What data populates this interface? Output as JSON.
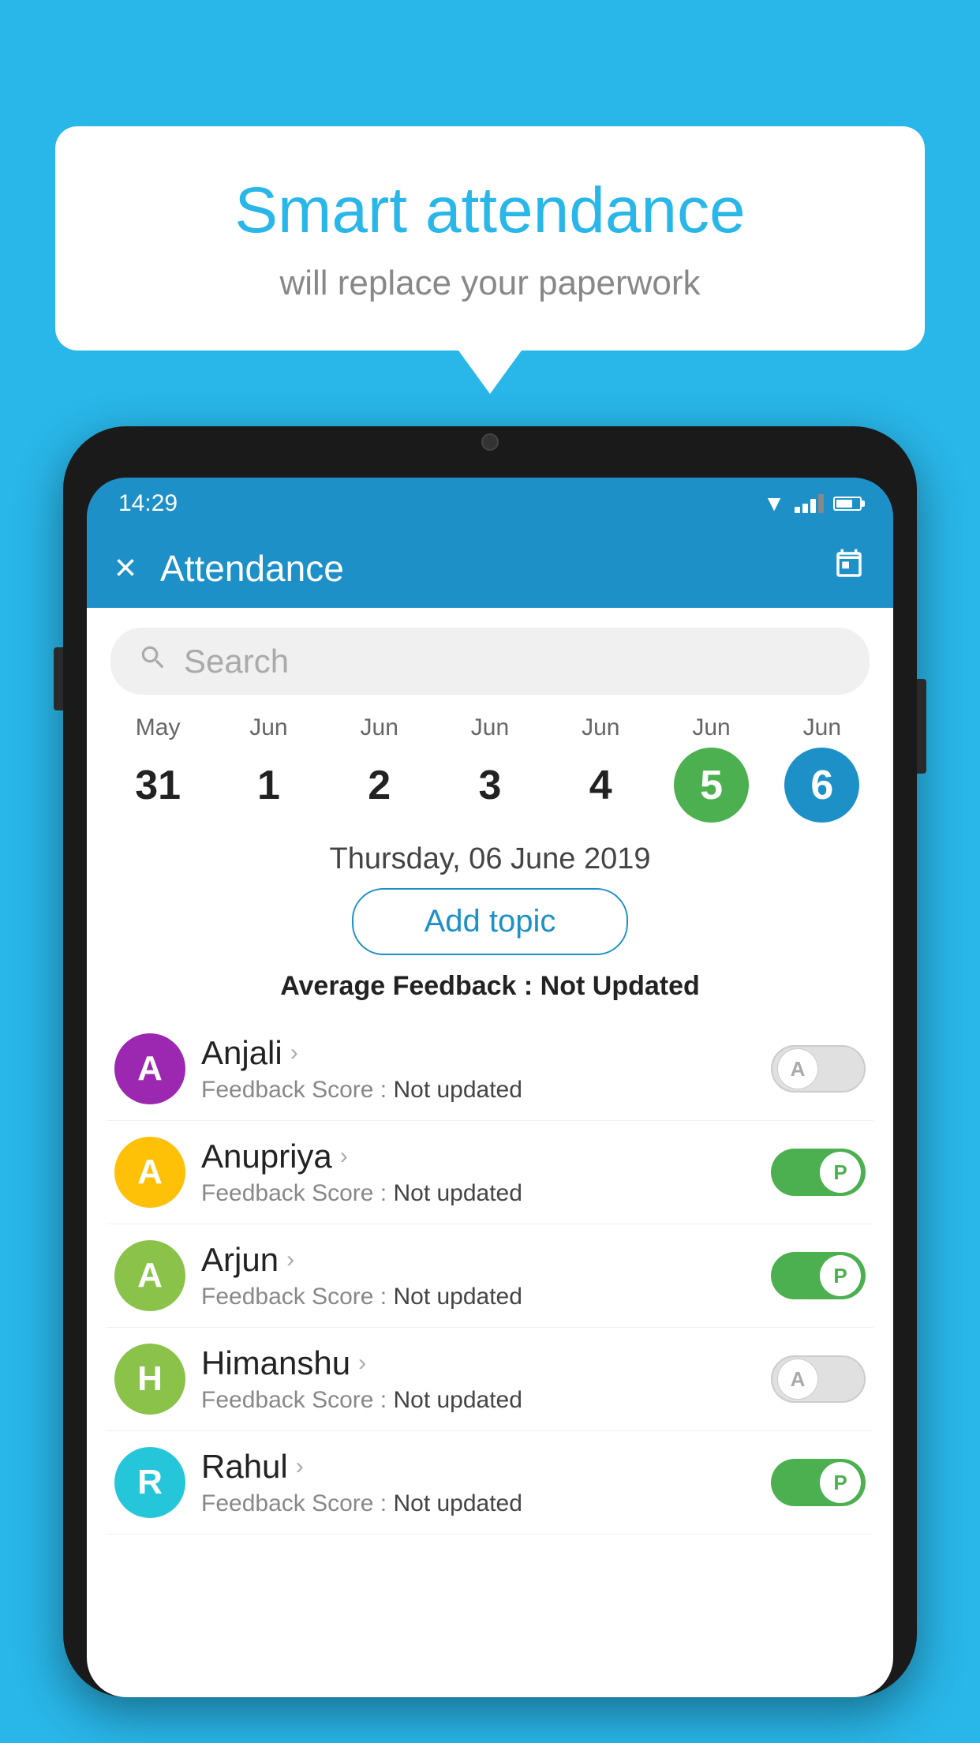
{
  "background_color": "#29b6e8",
  "speech_bubble": {
    "title": "Smart attendance",
    "subtitle": "will replace your paperwork"
  },
  "status_bar": {
    "time": "14:29",
    "wifi": "▼",
    "battery_label": "battery"
  },
  "app_header": {
    "close_label": "×",
    "title": "Attendance",
    "calendar_label": "📅"
  },
  "search": {
    "placeholder": "Search"
  },
  "calendar": {
    "days": [
      {
        "month": "May",
        "num": "31",
        "highlight": "none"
      },
      {
        "month": "Jun",
        "num": "1",
        "highlight": "none"
      },
      {
        "month": "Jun",
        "num": "2",
        "highlight": "none"
      },
      {
        "month": "Jun",
        "num": "3",
        "highlight": "none"
      },
      {
        "month": "Jun",
        "num": "4",
        "highlight": "none"
      },
      {
        "month": "Jun",
        "num": "5",
        "highlight": "green"
      },
      {
        "month": "Jun",
        "num": "6",
        "highlight": "blue"
      }
    ]
  },
  "selected_date": "Thursday, 06 June 2019",
  "add_topic_label": "Add topic",
  "avg_feedback_label": "Average Feedback : ",
  "avg_feedback_value": "Not Updated",
  "students": [
    {
      "name": "Anjali",
      "initial": "A",
      "color": "#9c27b0",
      "feedback_label": "Feedback Score : ",
      "feedback_value": "Not updated",
      "toggle": "off",
      "toggle_label": "A"
    },
    {
      "name": "Anupriya",
      "initial": "A",
      "color": "#ffc107",
      "feedback_label": "Feedback Score : ",
      "feedback_value": "Not updated",
      "toggle": "on",
      "toggle_label": "P"
    },
    {
      "name": "Arjun",
      "initial": "A",
      "color": "#8bc34a",
      "feedback_label": "Feedback Score : ",
      "feedback_value": "Not updated",
      "toggle": "on",
      "toggle_label": "P"
    },
    {
      "name": "Himanshu",
      "initial": "H",
      "color": "#8bc34a",
      "feedback_label": "Feedback Score : ",
      "feedback_value": "Not updated",
      "toggle": "off",
      "toggle_label": "A"
    },
    {
      "name": "Rahul",
      "initial": "R",
      "color": "#26c6da",
      "feedback_label": "Feedback Score : ",
      "feedback_value": "Not updated",
      "toggle": "on",
      "toggle_label": "P"
    }
  ]
}
